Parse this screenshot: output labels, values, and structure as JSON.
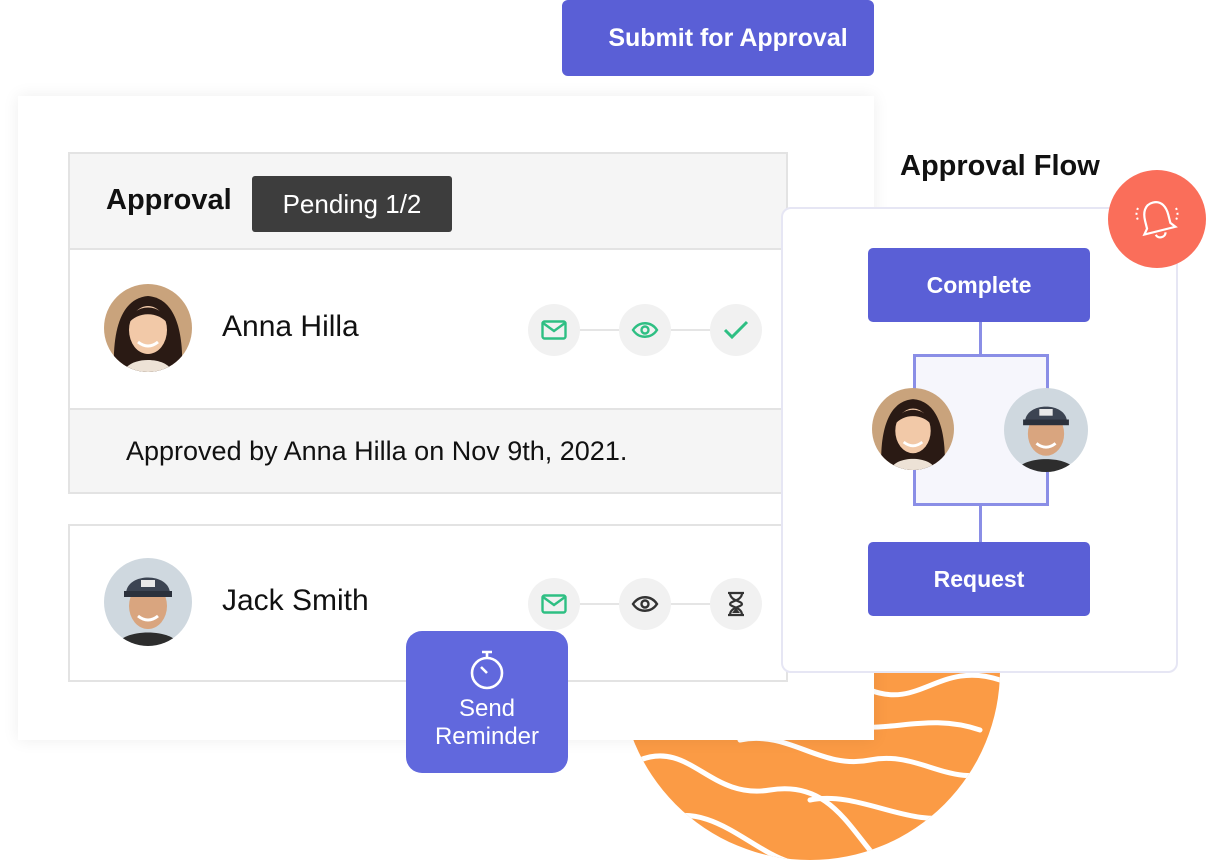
{
  "toolbar": {
    "submit_label": "Submit for Approval"
  },
  "approval": {
    "title": "Approval",
    "status_badge": "Pending 1/2",
    "approvers": [
      {
        "name": "Anna Hilla",
        "steps": [
          "mail-icon",
          "eye-icon",
          "check-icon"
        ]
      },
      {
        "name": "Jack Smith",
        "steps": [
          "mail-icon",
          "eye-icon",
          "hourglass-icon"
        ]
      }
    ],
    "approved_note": "Approved by Anna Hilla on Nov 9th, 2021."
  },
  "reminder": {
    "line1": "Send",
    "line2": "Reminder",
    "icon": "stopwatch-icon"
  },
  "flow": {
    "title": "Approval Flow",
    "top_button": "Complete",
    "bottom_button": "Request",
    "alert_icon": "bell-icon"
  },
  "colors": {
    "accent": "#5a5fd6",
    "step_icon": "#2ebf83",
    "alert": "#fa6e5a",
    "blob": "#fb9b45"
  }
}
